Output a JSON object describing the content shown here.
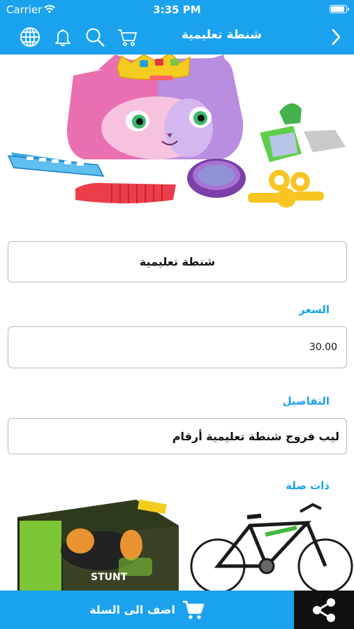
{
  "status_bar": {
    "carrier": "Carrier",
    "time": "3:35 PM"
  },
  "nav": {
    "title": "شنطة تعليمية",
    "icons": [
      "globe-icon",
      "bell-icon",
      "search-icon",
      "cart-icon",
      "chevron-right-icon"
    ]
  },
  "product": {
    "name": "شنطة تعليمية",
    "price_label": "السعر",
    "price": "30.00",
    "details_label": "التفاصيل",
    "details": "ليب فروج شنطة تعليمية أرقام"
  },
  "related": {
    "label": "ذات صلة",
    "items": [
      "bicycle",
      "stunt-car-toy"
    ]
  },
  "bottom_bar": {
    "add_to_cart_label": "اضف الى السلة"
  },
  "colors": {
    "accent": "#1aa2ef",
    "share_bg": "#111111",
    "border": "#b8b8b8"
  }
}
